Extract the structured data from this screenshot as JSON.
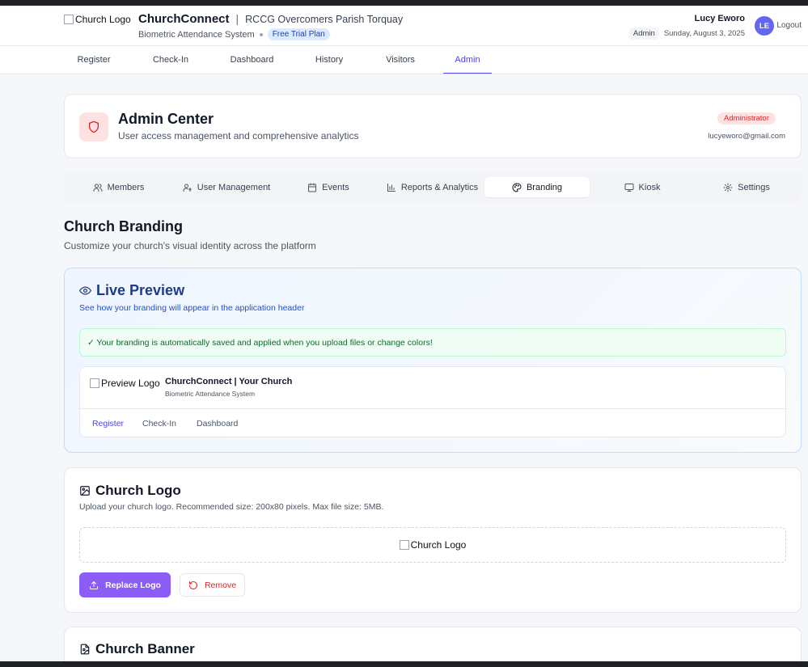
{
  "header": {
    "logo_alt": "Church Logo",
    "app_name": "ChurchConnect",
    "separator": "|",
    "parish": "RCCG Overcomers Parish Torquay",
    "subtitle": "Biometric Attendance System",
    "plan_badge": "Free Trial Plan",
    "user_name": "Lucy Eworo",
    "user_role": "Admin",
    "date": "Sunday, August 3, 2025",
    "avatar_initials": "LE",
    "logout_label": "Logout"
  },
  "nav": {
    "items": [
      "Register",
      "Check-In",
      "Dashboard",
      "History",
      "Visitors",
      "Admin"
    ],
    "active": "Admin"
  },
  "admin": {
    "title": "Admin Center",
    "subtitle": "User access management and comprehensive analytics",
    "badge": "Administrator",
    "email": "lucyeworo@gmail.com"
  },
  "subtabs": {
    "items": [
      {
        "label": "Members",
        "icon": "users-icon"
      },
      {
        "label": "User Management",
        "icon": "user-key-icon"
      },
      {
        "label": "Events",
        "icon": "calendar-icon"
      },
      {
        "label": "Reports & Analytics",
        "icon": "bar-chart-icon"
      },
      {
        "label": "Branding",
        "icon": "palette-icon"
      },
      {
        "label": "Kiosk",
        "icon": "monitor-icon"
      },
      {
        "label": "Settings",
        "icon": "gear-icon"
      }
    ],
    "active": "Branding"
  },
  "section": {
    "title": "Church Branding",
    "subtitle": "Customize your church's visual identity across the platform"
  },
  "preview": {
    "title": "Live Preview",
    "subtitle": "See how your branding will appear in the application header",
    "alert": "✓ Your branding is automatically saved and applied when you upload files or change colors!",
    "logo_alt": "Preview Logo",
    "app_name": "ChurchConnect | Your Church",
    "app_sub": "Biometric Attendance System",
    "nav": [
      "Register",
      "Check-In",
      "Dashboard"
    ],
    "active_nav": "Register"
  },
  "church_logo": {
    "title": "Church Logo",
    "subtitle": "Upload your church logo. Recommended size: 200x80 pixels. Max file size: 5MB.",
    "image_alt": "Church Logo",
    "replace_label": "Replace Logo",
    "remove_label": "Remove"
  },
  "church_banner": {
    "title": "Church Banner"
  },
  "colors": {
    "accent": "#4f46e5",
    "primary_button": "#8b5cf6",
    "danger": "#dc2626",
    "preview_title": "#1e3a8a",
    "success_text": "#166534"
  }
}
